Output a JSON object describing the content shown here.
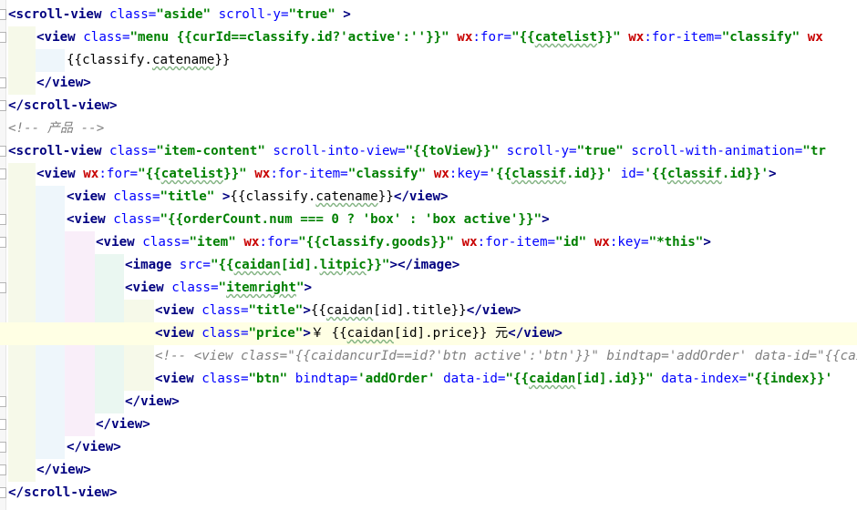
{
  "code_lines": [
    {
      "segments": [
        {
          "c": "tb",
          "t": "<scroll-view"
        },
        {
          "c": "an",
          "t": " class="
        },
        {
          "c": "av",
          "t": "\"aside\""
        },
        {
          "c": "an",
          "t": " scroll-y="
        },
        {
          "c": "av",
          "t": "\"true\""
        },
        {
          "c": "tb",
          "t": " >"
        }
      ]
    },
    {
      "segments": [
        {
          "c": "tb",
          "t": "<view"
        },
        {
          "c": "an",
          "t": " class="
        },
        {
          "c": "av",
          "t": "\"menu {{curId==classify.id?'active':''}}\""
        },
        {
          "c": "tx",
          "t": " "
        },
        {
          "c": "pr",
          "t": "wx"
        },
        {
          "c": "an",
          "t": ":for="
        },
        {
          "c": "av",
          "t": "\"{{"
        },
        {
          "c": "av sq",
          "t": "catelist"
        },
        {
          "c": "av",
          "t": "}}\""
        },
        {
          "c": "tx",
          "t": " "
        },
        {
          "c": "pr",
          "t": "wx"
        },
        {
          "c": "an",
          "t": ":for-item="
        },
        {
          "c": "av",
          "t": "\"classify\""
        },
        {
          "c": "tx",
          "t": " "
        },
        {
          "c": "pr",
          "t": "wx"
        }
      ]
    },
    {
      "segments": [
        {
          "c": "tx",
          "t": "{{classify."
        },
        {
          "c": "tx sq",
          "t": "catename"
        },
        {
          "c": "tx",
          "t": "}}"
        }
      ]
    },
    {
      "segments": [
        {
          "c": "tb",
          "t": "</view>"
        }
      ]
    },
    {
      "segments": [
        {
          "c": "tb",
          "t": "</scroll-view>"
        }
      ]
    },
    {
      "segments": [
        {
          "c": "cm",
          "t": "<!-- 产品 -->"
        }
      ]
    },
    {
      "segments": [
        {
          "c": "tb",
          "t": "<scroll-view"
        },
        {
          "c": "an",
          "t": " class="
        },
        {
          "c": "av",
          "t": "\"item-content\""
        },
        {
          "c": "an",
          "t": " scroll-into-view="
        },
        {
          "c": "av",
          "t": "\"{{toView}}\""
        },
        {
          "c": "an",
          "t": " scroll-y="
        },
        {
          "c": "av",
          "t": "\"true\""
        },
        {
          "c": "an",
          "t": " scroll-with-animation="
        },
        {
          "c": "av",
          "t": "\"tr"
        }
      ]
    },
    {
      "segments": [
        {
          "c": "tb",
          "t": "<view"
        },
        {
          "c": "tx",
          "t": " "
        },
        {
          "c": "pr",
          "t": "wx"
        },
        {
          "c": "an",
          "t": ":for="
        },
        {
          "c": "av",
          "t": "\"{{"
        },
        {
          "c": "av sq",
          "t": "catelist"
        },
        {
          "c": "av",
          "t": "}}\""
        },
        {
          "c": "tx",
          "t": " "
        },
        {
          "c": "pr",
          "t": "wx"
        },
        {
          "c": "an",
          "t": ":for-item="
        },
        {
          "c": "av",
          "t": "\"classify\""
        },
        {
          "c": "tx",
          "t": " "
        },
        {
          "c": "pr",
          "t": "wx"
        },
        {
          "c": "an",
          "t": ":key="
        },
        {
          "c": "av",
          "t": "'{{"
        },
        {
          "c": "av sq",
          "t": "classif"
        },
        {
          "c": "av",
          "t": ".id}}'"
        },
        {
          "c": "an",
          "t": " id="
        },
        {
          "c": "av",
          "t": "'{{"
        },
        {
          "c": "av sq",
          "t": "classif"
        },
        {
          "c": "av",
          "t": ".id}}'"
        },
        {
          "c": "tb",
          "t": ">"
        }
      ]
    },
    {
      "segments": [
        {
          "c": "tb",
          "t": "<view"
        },
        {
          "c": "an",
          "t": " class="
        },
        {
          "c": "av",
          "t": "\"title\""
        },
        {
          "c": "tb",
          "t": " >"
        },
        {
          "c": "tx",
          "t": "{{classify."
        },
        {
          "c": "tx sq",
          "t": "catename"
        },
        {
          "c": "tx",
          "t": "}}"
        },
        {
          "c": "tb",
          "t": "</view>"
        }
      ]
    },
    {
      "segments": [
        {
          "c": "tb",
          "t": "<view"
        },
        {
          "c": "an",
          "t": " class="
        },
        {
          "c": "av",
          "t": "\"{{orderCount.num === 0 ? 'box' : 'box active'}}\""
        },
        {
          "c": "tb",
          "t": ">"
        }
      ]
    },
    {
      "segments": [
        {
          "c": "tb",
          "t": "<view"
        },
        {
          "c": "an",
          "t": " class="
        },
        {
          "c": "av",
          "t": "\"item\""
        },
        {
          "c": "tx",
          "t": " "
        },
        {
          "c": "pr",
          "t": "wx"
        },
        {
          "c": "an",
          "t": ":for="
        },
        {
          "c": "av",
          "t": "\"{{classify.goods}}\""
        },
        {
          "c": "tx",
          "t": " "
        },
        {
          "c": "pr",
          "t": "wx"
        },
        {
          "c": "an",
          "t": ":for-item="
        },
        {
          "c": "av",
          "t": "\"id\""
        },
        {
          "c": "tx",
          "t": " "
        },
        {
          "c": "pr",
          "t": "wx"
        },
        {
          "c": "an",
          "t": ":key="
        },
        {
          "c": "av",
          "t": "\"*this\""
        },
        {
          "c": "tb",
          "t": ">"
        }
      ]
    },
    {
      "segments": [
        {
          "c": "tb",
          "t": "<image"
        },
        {
          "c": "an",
          "t": " src="
        },
        {
          "c": "av",
          "t": "\"{{"
        },
        {
          "c": "av sq",
          "t": "caidan"
        },
        {
          "c": "av",
          "t": "[id]."
        },
        {
          "c": "av sq",
          "t": "litpic"
        },
        {
          "c": "av",
          "t": "}}\""
        },
        {
          "c": "tb",
          "t": "></image>"
        }
      ]
    },
    {
      "segments": [
        {
          "c": "tb",
          "t": "<view"
        },
        {
          "c": "an",
          "t": " class="
        },
        {
          "c": "av",
          "t": "\""
        },
        {
          "c": "av sq",
          "t": "itemright"
        },
        {
          "c": "av",
          "t": "\""
        },
        {
          "c": "tb",
          "t": ">"
        }
      ]
    },
    {
      "segments": [
        {
          "c": "tb",
          "t": "<view"
        },
        {
          "c": "an",
          "t": " class="
        },
        {
          "c": "av",
          "t": "\"title\""
        },
        {
          "c": "tb",
          "t": ">"
        },
        {
          "c": "tx",
          "t": "{{"
        },
        {
          "c": "tx sq",
          "t": "caidan"
        },
        {
          "c": "tx",
          "t": "[id].title}}"
        },
        {
          "c": "tb",
          "t": "</view>"
        }
      ]
    },
    {
      "segments": [
        {
          "c": "tb",
          "t": "<view"
        },
        {
          "c": "an",
          "t": " class="
        },
        {
          "c": "av",
          "t": "\"price\""
        },
        {
          "c": "tb",
          "t": ">"
        },
        {
          "c": "tx",
          "t": "￥ {{"
        },
        {
          "c": "tx sq",
          "t": "caidan"
        },
        {
          "c": "tx",
          "t": "[id].price}} 元"
        },
        {
          "c": "tb",
          "t": "</view>"
        }
      ]
    },
    {
      "segments": [
        {
          "c": "cm",
          "t": "<!-- <view class=\"{{caidancurId==id?'btn active':'btn'}}\" bindtap='addOrder' data-id=\"{{caidan[id"
        }
      ]
    },
    {
      "segments": [
        {
          "c": "tb",
          "t": "<view"
        },
        {
          "c": "an",
          "t": " class="
        },
        {
          "c": "av",
          "t": "\"btn\""
        },
        {
          "c": "an",
          "t": " bindtap="
        },
        {
          "c": "av",
          "t": "'addOrder'"
        },
        {
          "c": "an",
          "t": " data-id="
        },
        {
          "c": "av",
          "t": "\"{{"
        },
        {
          "c": "av sq",
          "t": "caidan"
        },
        {
          "c": "av",
          "t": "[id].id}}\""
        },
        {
          "c": "an",
          "t": " data-index="
        },
        {
          "c": "av",
          "t": "\"{{index}}'"
        }
      ]
    },
    {
      "segments": [
        {
          "c": "tb",
          "t": "</view>"
        }
      ]
    },
    {
      "segments": [
        {
          "c": "tb",
          "t": "</view>"
        }
      ]
    },
    {
      "segments": [
        {
          "c": "tb",
          "t": "</view>"
        }
      ]
    },
    {
      "segments": [
        {
          "c": "tb",
          "t": "</view>"
        }
      ]
    },
    {
      "segments": [
        {
          "c": "tb",
          "t": "</scroll-view>"
        }
      ]
    }
  ]
}
